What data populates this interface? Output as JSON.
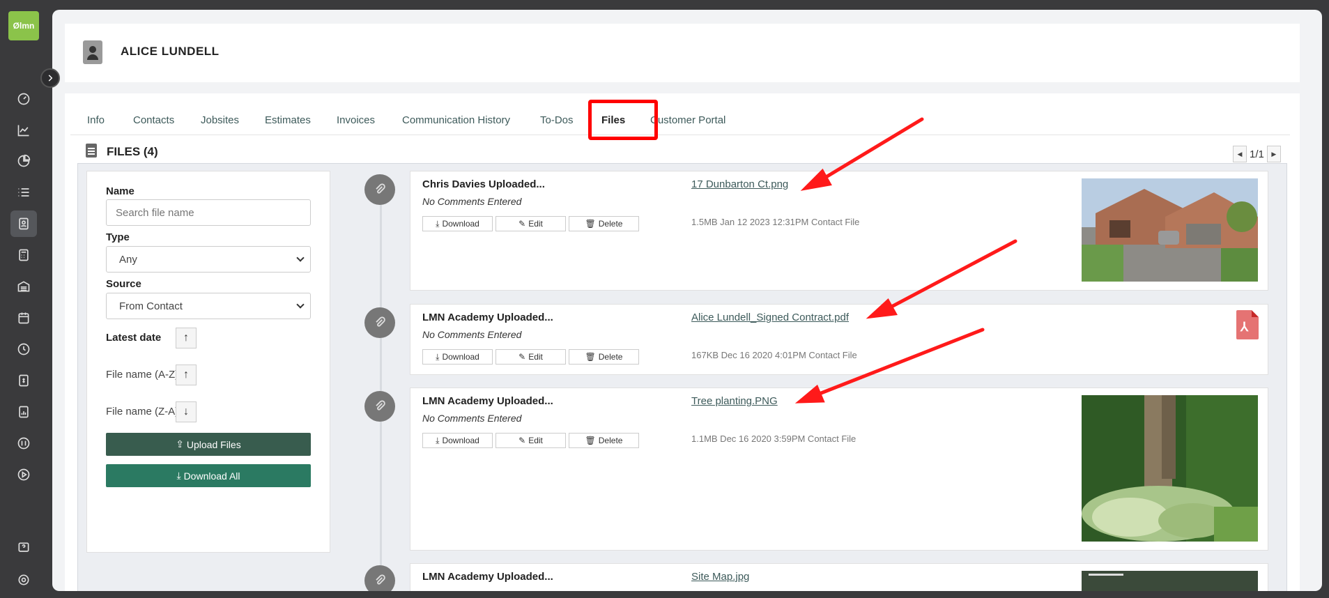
{
  "app": {
    "logo_text": "Ølmn"
  },
  "sidebar": {
    "items": [
      {
        "name": "dashboard-icon"
      },
      {
        "name": "chart-line-icon"
      },
      {
        "name": "pie-chart-icon"
      },
      {
        "name": "list-icon"
      },
      {
        "name": "contact-card-icon"
      },
      {
        "name": "calculator-icon"
      },
      {
        "name": "warehouse-icon"
      },
      {
        "name": "calendar-icon"
      },
      {
        "name": "clock-icon"
      },
      {
        "name": "invoice-icon"
      },
      {
        "name": "report-icon"
      },
      {
        "name": "quickbooks-icon"
      },
      {
        "name": "play-icon"
      },
      {
        "name": "help-icon"
      },
      {
        "name": "settings-icon"
      }
    ]
  },
  "header": {
    "title": "ALICE LUNDELL"
  },
  "tabs": [
    {
      "label": "Info"
    },
    {
      "label": "Contacts"
    },
    {
      "label": "Jobsites"
    },
    {
      "label": "Estimates"
    },
    {
      "label": "Invoices"
    },
    {
      "label": "Communication History"
    },
    {
      "label": "To-Dos"
    },
    {
      "label": "Files"
    },
    {
      "label": "Customer Portal"
    }
  ],
  "files": {
    "title": "FILES (4)",
    "pager": "1/1"
  },
  "filters": {
    "name_label": "Name",
    "name_placeholder": "Search file name",
    "type_label": "Type",
    "type_value": "Any",
    "source_label": "Source",
    "source_value": "From Contact",
    "latest_label": "Latest date",
    "az_label": "File name (A-Z)",
    "za_label": "File name (Z-A)",
    "upload_label": "Upload Files",
    "download_all_label": "Download All"
  },
  "file_list": [
    {
      "uploader": "Chris Davies Uploaded...",
      "comment": "No Comments Entered",
      "filename": "17 Dunbarton Ct.png",
      "meta": "1.5MB Jan 12 2023 12:31PM Contact File",
      "download": "Download",
      "edit": "Edit",
      "delete": "Delete"
    },
    {
      "uploader": "LMN Academy Uploaded...",
      "comment": "No Comments Entered",
      "filename": "Alice Lundell_Signed Contract.pdf",
      "meta": "167KB Dec 16 2020 4:01PM Contact File",
      "download": "Download",
      "edit": "Edit",
      "delete": "Delete"
    },
    {
      "uploader": "LMN Academy Uploaded...",
      "comment": "No Comments Entered",
      "filename": "Tree planting.PNG",
      "meta": "1.1MB Dec 16 2020 3:59PM Contact File",
      "download": "Download",
      "edit": "Edit",
      "delete": "Delete"
    },
    {
      "uploader": "LMN Academy Uploaded...",
      "filename": "Site Map.jpg"
    }
  ],
  "colors": {
    "accent_green": "#8bc34a",
    "highlight_red": "#ff0000",
    "upload_btn": "#385c4e",
    "download_all_btn": "#2b7a62"
  }
}
